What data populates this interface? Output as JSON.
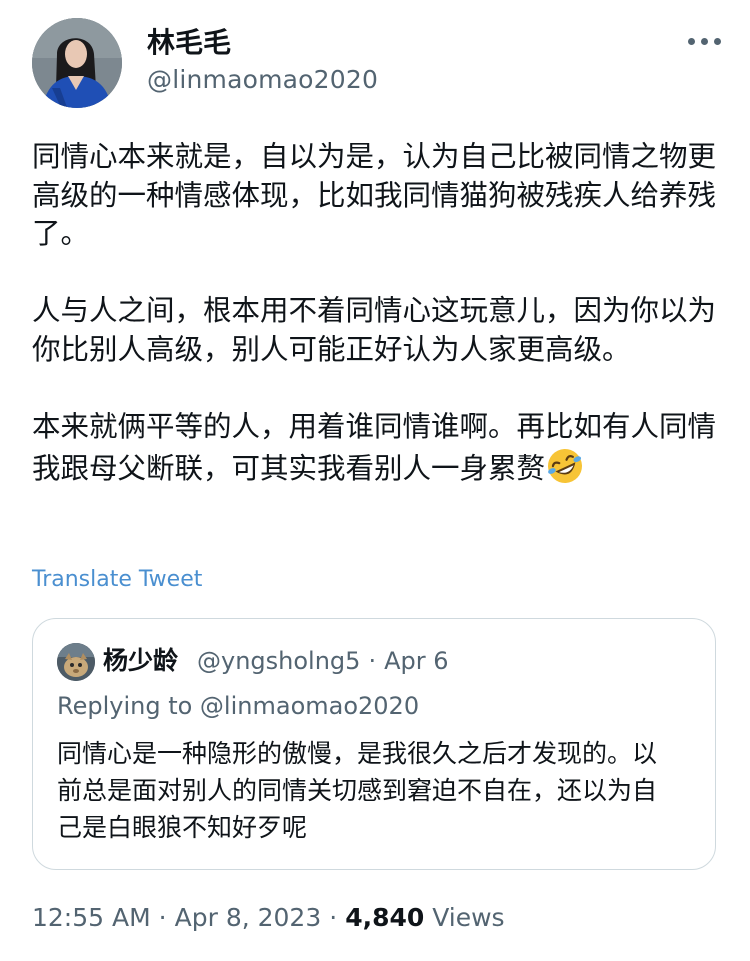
{
  "author": {
    "name": "林毛毛",
    "handle": "@linmaomao2020"
  },
  "tweet": {
    "paragraphs": [
      "同情心本来就是，自以为是，认为自己比被同情之物更高级的一种情感体现，比如我同情猫狗被残疾人给养残了。",
      "人与人之间，根本用不着同情心这玩意儿，因为你以为你比别人高级，别人可能正好认为人家更高级。",
      "本来就俩平等的人，用着谁同情谁啊。再比如有人同情我跟母父断联，可其实我看别人一身累赘"
    ],
    "emoji": "rolling-on-floor-laughing",
    "translate_label": "Translate Tweet"
  },
  "quote": {
    "name": "杨少龄",
    "handle": "@yngsholng5",
    "date": "Apr 6",
    "replying_to": "Replying to @linmaomao2020",
    "text": "同情心是一种隐形的傲慢，是我很久之后才发现的。以前总是面对别人的同情关切感到窘迫不自在，还以为自己是白眼狼不知好歹呢"
  },
  "footer": {
    "time": "12:55 AM",
    "date": "Apr 8, 2023",
    "views_count": "4,840",
    "views_label": "Views"
  },
  "icons": {
    "more": "more-horizontal-icon"
  },
  "colors": {
    "link": "#4a8fd0",
    "secondary_text": "#536471",
    "border": "#cfd9de"
  }
}
